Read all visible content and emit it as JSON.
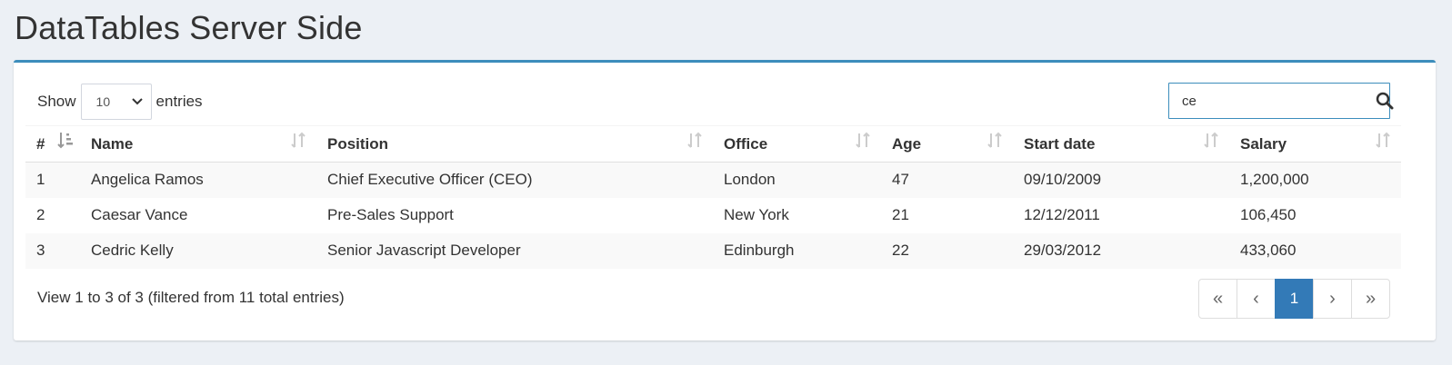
{
  "page": {
    "title": "DataTables Server Side"
  },
  "length": {
    "show_label": "Show",
    "selected": "10",
    "entries_label": "entries"
  },
  "search": {
    "value": "ce"
  },
  "table": {
    "columns": [
      "#",
      "Name",
      "Position",
      "Office",
      "Age",
      "Start date",
      "Salary"
    ],
    "rows": [
      [
        "1",
        "Angelica Ramos",
        "Chief Executive Officer (CEO)",
        "London",
        "47",
        "09/10/2009",
        "1,200,000"
      ],
      [
        "2",
        "Caesar Vance",
        "Pre-Sales Support",
        "New York",
        "21",
        "12/12/2011",
        "106,450"
      ],
      [
        "3",
        "Cedric Kelly",
        "Senior Javascript Developer",
        "Edinburgh",
        "22",
        "29/03/2012",
        "433,060"
      ]
    ]
  },
  "info": "View 1 to 3 of 3 (filtered from 11 total entries)",
  "pagination": {
    "first": "«",
    "prev": "‹",
    "current": "1",
    "next": "›",
    "last": "»"
  },
  "colors": {
    "accent": "#3c8dbc",
    "active_page": "#337ab7",
    "background": "#ecf0f5"
  }
}
